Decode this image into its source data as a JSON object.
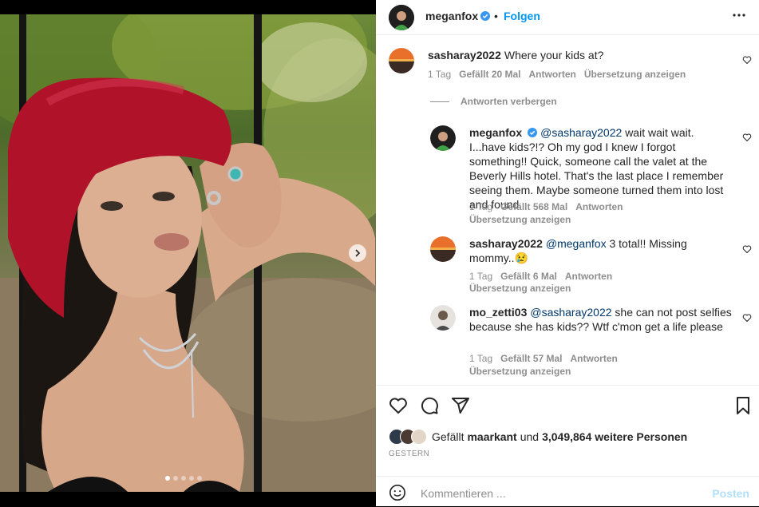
{
  "header": {
    "username": "meganfox",
    "bullet": "•",
    "follow_label": "Folgen"
  },
  "comments": [
    {
      "username": "sasharay2022",
      "text": "Where your kids at?",
      "age": "1 Tag",
      "likes": "Gefällt 20 Mal",
      "reply_label": "Antworten",
      "translate_label": "Übersetzung anzeigen"
    }
  ],
  "hide_replies_label": "Antworten verbergen",
  "replies": [
    {
      "username": "meganfox",
      "mention": "@sasharay2022",
      "text": "wait wait wait. I...have kids?!? Oh my god I knew I forgot something!! Quick, someone call the valet at the Beverly Hills hotel. That's the last place I remember seeing them. Maybe someone turned them into lost and found",
      "age": "1 Tag",
      "likes": "Gefällt 568 Mal",
      "reply_label": "Antworten",
      "translate_label": "Übersetzung anzeigen"
    },
    {
      "username": "sasharay2022",
      "mention": "@meganfox",
      "text": "3 total!! Missing mommy..😢",
      "age": "1 Tag",
      "likes": "Gefällt 6 Mal",
      "reply_label": "Antworten",
      "translate_label": "Übersetzung anzeigen"
    },
    {
      "username": "mo_zetti03",
      "mention": "@sasharay2022",
      "text": "she can not post selfies because she has kids?? Wtf c'mon get a life please",
      "age": "1 Tag",
      "likes": "Gefällt 57 Mal",
      "reply_label": "Antworten",
      "translate_label": "Übersetzung anzeigen"
    }
  ],
  "likes_line": {
    "prefix": "Gefällt",
    "user": "maarkant",
    "connector": "und",
    "count": "3,049,864 weitere Personen"
  },
  "post_date": "GESTERN",
  "composer": {
    "placeholder": "Kommentieren ...",
    "post_label": "Posten"
  },
  "carousel": {
    "total": 5,
    "current": 1
  },
  "colors": {
    "accent": "#0095f6",
    "post_disabled": "#b2dffc",
    "verified": "#3897f0",
    "hat": "#b0122a"
  },
  "icons": [
    "verified-icon",
    "more-icon",
    "heart-icon",
    "comment-icon",
    "share-icon",
    "bookmark-icon",
    "emoji-icon",
    "chevron-right-icon"
  ]
}
